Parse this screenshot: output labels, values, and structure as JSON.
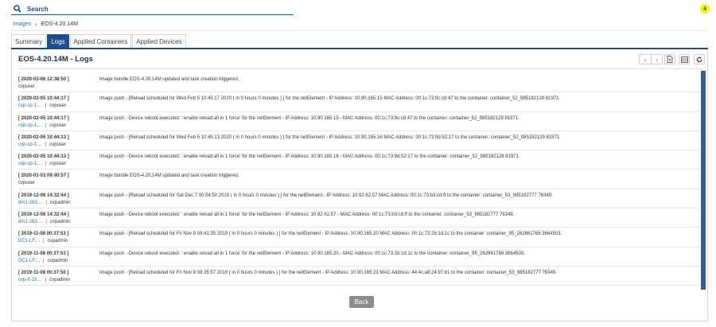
{
  "search": {
    "label": "Search"
  },
  "notifications": {
    "count": "4",
    "color": "#f5f500"
  },
  "breadcrumb": {
    "root": "Images",
    "separator": "›",
    "current": "EOS-4.20.14M"
  },
  "tabs": [
    {
      "label": "Summary",
      "active": false
    },
    {
      "label": "Logs",
      "active": true
    },
    {
      "label": "Applied Containers",
      "active": false
    },
    {
      "label": "Applied Devices",
      "active": false
    }
  ],
  "panel": {
    "title": "EOS-4.20.14M - Logs"
  },
  "toolbar": {
    "icons": [
      "chevron-left-icon",
      "chevron-right-icon",
      "export-file-icon",
      "columns-icon",
      "refresh-icon"
    ]
  },
  "logs": [
    {
      "time": "[ 2020-03-06 12:38:50 ]",
      "device": "",
      "user": "cvpuser",
      "message": "Image bundle EOS-4.20.14M updated and task creation triggered."
    },
    {
      "time": "[ 2020-02-05 10:44:17 ]",
      "device": "cvp-sp-1....",
      "user": "cvpuser",
      "message": "Image push - [Reload scheduled for Wed Feb 5 10:45:17 2020 ( in 0 hours 0 minutes ) ] for the netElement - IP Address: 10.90.165.15 MAC Address: 00:1c:73:9c:c8:47 to the container: container_52_985182129 81971."
    },
    {
      "time": "[ 2020-02-05 10:44:17 ]",
      "device": "cvp-sp-1....",
      "user": "cvpuser",
      "message": "Image push - Device reboot executed: ' enable reload all in 1 force' for the netElement - IP Address: 10.90.165.15 - MAC Address: 00:1c:73:9c:c8:47 to the container: container_52_985182129 81971."
    },
    {
      "time": "[ 2020-02-05 10:44:13 ]",
      "device": "cvp-sp-1....",
      "user": "cvpuser",
      "message": "Image push - [Reload scheduled for Wed Feb 5 10:45:13 2020 ( in 0 hours 0 minutes ) ] for the netElement - IP Address: 10.90.165.16 MAC Address: 00:1c:73:9d:52:17 to the container: container_52_985182129 81971."
    },
    {
      "time": "[ 2020-02-05 10:44:13 ]",
      "device": "cvp-sp-1....",
      "user": "cvpuser",
      "message": "Image push - Device reboot executed: ' enable reload all in 1 force' for the netElement - IP Address: 10.90.165.16 - MAC Address: 00:1c:73:9d:52:17 to the container: container_52_985182129 81971."
    },
    {
      "time": "[ 2020-01-03 09:40:57 ]",
      "device": "",
      "user": "cvpuser",
      "message": "Image bundle EOS-4.20.14M updated and task creation triggered."
    },
    {
      "time": "[ 2019-12-06 14:32:44 ]",
      "device": "dm1-263....",
      "user": "cvpadmin",
      "message": "Image push - [Reload scheduled for Sat Dec 7 00:54:50 2019 ( in 0 hours 0 minutes ) ] for the netElement - IP Address: 10.92.62.57 MAC Address: 00:1c:73:b3:cd:ff to the container: container_53_985182777 76349."
    },
    {
      "time": "[ 2019-12-06 14:32:44 ]",
      "device": "dm1-263....",
      "user": "cvpadmin",
      "message": "Image push - Device reboot executed: ' enable reload all in 1 force' for the netElement - IP Address: 10.92.62.57 - MAC Address: 00:1c:73:b3:cd:ff to the container: container_53_985182777 76349."
    },
    {
      "time": "[ 2019-11-08 00:37:53 ]",
      "device": "DC1-LF....",
      "user": "cvpadmin",
      "message": "Image push - [Reload scheduled for Fri Nov 8 08:41:35 2019 ( in 0 hours 0 minutes ) ] for the netElement - IP Address: 10.90.165.20 MAC Address: 00:1c:73:2b:1d:1c to the container: container_95_262861768 3664503."
    },
    {
      "time": "[ 2019-11-08 00:37:53 ]",
      "device": "DC1-LF....",
      "user": "cvpadmin",
      "message": "Image push - Device reboot executed: ' enable reload all in 1 force' for the netElement - IP Address: 10.90.165.20 - MAC Address: 00:1c:73:2b:1d:1c to the container: container_95_262861768 3664503."
    },
    {
      "time": "[ 2019-11-08 00:37:50 ]",
      "device": "cvp-lf-23....",
      "user": "cvpadmin",
      "message": "Image push - [Reload scheduled for Fri Nov 8 08:35:57 2019 ( in 0 hours 0 minutes ) ] for the netElement - IP Address: 10.90.165.23 MAC Address: 44:4c:a8:24:97:81 to the container: container_53_985182777 76349."
    }
  ],
  "back_button": {
    "label": "Back"
  },
  "colors": {
    "accent": "#1e4f8c",
    "link": "#1e6fb8",
    "button": "#8c8c8c"
  }
}
